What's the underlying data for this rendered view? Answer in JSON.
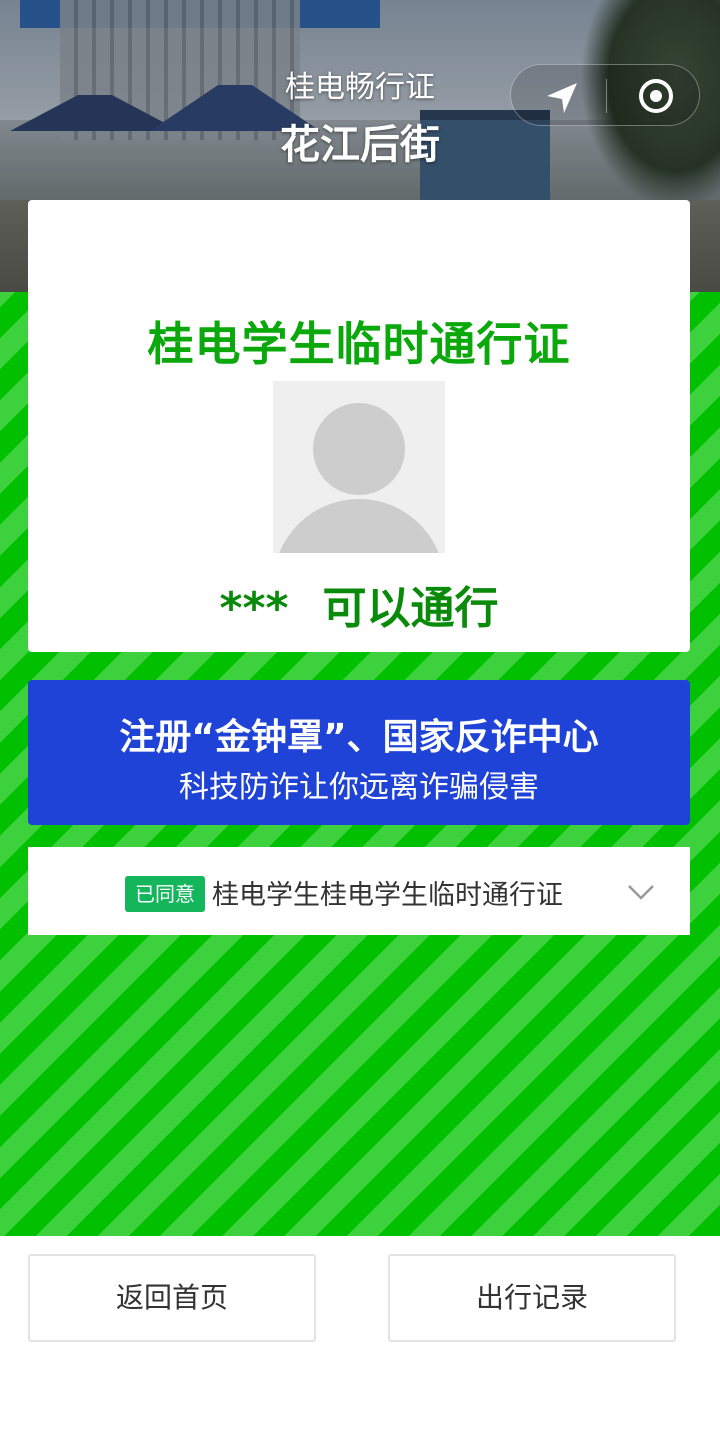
{
  "header": {
    "app_title": "桂电畅行证",
    "location": "花江后街"
  },
  "capsule": {
    "nav_icon": "navigation-arrow-icon",
    "target_icon": "target-icon"
  },
  "card": {
    "pass_title": "桂电学生临时通行证",
    "avatar_icon": "default-avatar-icon",
    "name": "***",
    "status": "可以通行"
  },
  "banner": {
    "line1": "注册“金钟罩”、国家反诈中心",
    "line2": "科技防诈让你远离诈骗侵害"
  },
  "agreement": {
    "tag": "已同意",
    "text": "桂电学生桂电学生临时通行证",
    "chevron_icon": "chevron-down-icon"
  },
  "buttons": {
    "home": "返回首页",
    "records": "出行记录"
  },
  "colors": {
    "stripe_dark": "#00c000",
    "stripe_light": "#3dd23d",
    "title_green": "#0aa80a",
    "status_green": "#0a8a0a",
    "banner_blue": "#1f43d6",
    "tag_green": "#13b65a"
  }
}
